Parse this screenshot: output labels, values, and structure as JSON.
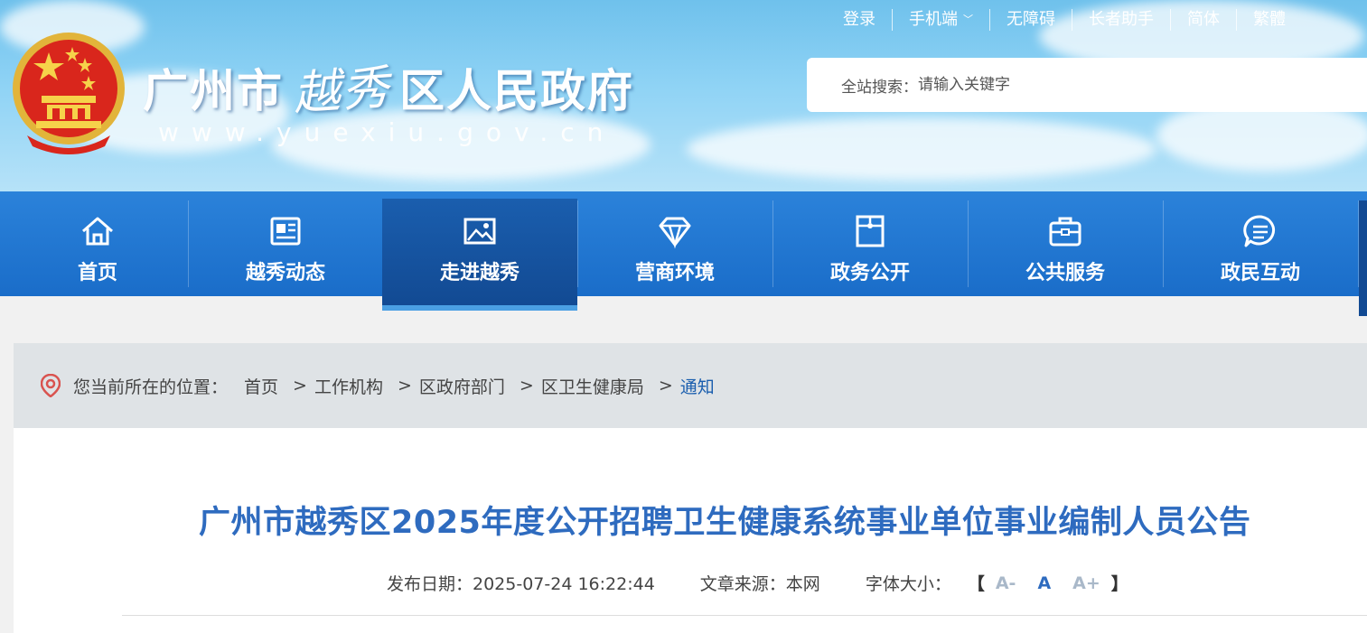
{
  "header": {
    "title_prefix": "广州市",
    "title_calligraphy": "越秀",
    "title_suffix": "区人民政府",
    "url": "www.yuexiu.gov.cn",
    "top_links": [
      {
        "label": "登录"
      },
      {
        "label": "手机端",
        "has_dropdown": true
      },
      {
        "label": "无障碍"
      },
      {
        "label": "长者助手"
      },
      {
        "label": "简体"
      },
      {
        "label": "繁體"
      }
    ],
    "search": {
      "label": "全站搜索：",
      "placeholder": "请输入关键字"
    }
  },
  "nav": {
    "items": [
      {
        "label": "首页",
        "icon": "home-icon"
      },
      {
        "label": "越秀动态",
        "icon": "news-icon"
      },
      {
        "label": "走进越秀",
        "icon": "picture-icon",
        "active": true
      },
      {
        "label": "营商环境",
        "icon": "diamond-icon"
      },
      {
        "label": "政务公开",
        "icon": "folder-icon"
      },
      {
        "label": "公共服务",
        "icon": "briefcase-icon"
      },
      {
        "label": "政民互动",
        "icon": "chat-icon"
      }
    ]
  },
  "breadcrumb": {
    "lead": "您当前所在的位置：",
    "items": [
      "首页",
      "工作机构",
      "区政府部门",
      "区卫生健康局",
      "通知"
    ],
    "separator": ">"
  },
  "article": {
    "title": "广州市越秀区2025年度公开招聘卫生健康系统事业单位事业编制人员公告",
    "publish_date": "发布日期：2025-07-24 16:22:44",
    "source": "文章来源：本网",
    "font_size_label": "字体大小：",
    "bracket_open": "【",
    "bracket_close": "】",
    "font_size_options": [
      "A-",
      "A",
      "A+"
    ]
  },
  "colors": {
    "nav_blue": "#1a6dc9",
    "nav_active": "#124a93",
    "title_blue": "#2e6bbf",
    "crumb_current": "#1a5eae"
  }
}
